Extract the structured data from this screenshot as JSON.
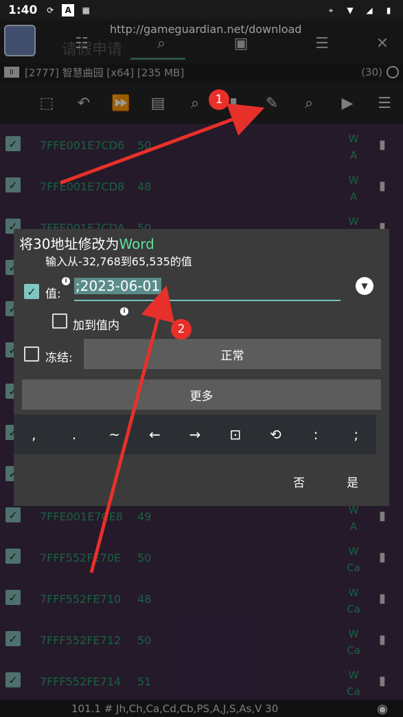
{
  "status": {
    "time": "1:40",
    "icons": [
      "sync-icon",
      "a-icon",
      "keyboard-icon"
    ],
    "right_icons": [
      "location-icon",
      "wifi-icon",
      "signal-icon",
      "battery-icon"
    ]
  },
  "header": {
    "url": "http://gameguardian.net/download",
    "bg_title": "请假申请"
  },
  "process": {
    "pause_label": "II",
    "info": "[2777] 智慧曲园 [x64] [235 MB]",
    "count": "(30)"
  },
  "toolbar": {
    "icons": [
      "select-all-icon",
      "undo-icon",
      "fast-forward-icon",
      "save-icon",
      "search-question-icon",
      "delete-icon",
      "edit-icon",
      "search-icon",
      "play-icon",
      "menu-icon"
    ]
  },
  "list": {
    "rows": [
      {
        "addr": "7FFE001E7CD6",
        "val": "50",
        "flag1": "W",
        "flag2": "A"
      },
      {
        "addr": "7FFE001E7CD8",
        "val": "48",
        "flag1": "W",
        "flag2": "A"
      },
      {
        "addr": "7FFE001E7CDA",
        "val": "50",
        "flag1": "W",
        "flag2": ""
      },
      {
        "addr": "",
        "val": "",
        "flag1": "",
        "flag2": ""
      },
      {
        "addr": "",
        "val": "",
        "flag1": "",
        "flag2": ""
      },
      {
        "addr": "",
        "val": "",
        "flag1": "",
        "flag2": ""
      },
      {
        "addr": "",
        "val": "",
        "flag1": "",
        "flag2": ""
      },
      {
        "addr": "",
        "val": "",
        "flag1": "",
        "flag2": ""
      },
      {
        "addr": "",
        "val": "",
        "flag1": "",
        "flag2": ""
      },
      {
        "addr": "7FFE001E7CE8",
        "val": "49",
        "flag1": "W",
        "flag2": "A"
      },
      {
        "addr": "7FFF552FE70E",
        "val": "50",
        "flag1": "W",
        "flag2": "Ca"
      },
      {
        "addr": "7FFF552FE710",
        "val": "48",
        "flag1": "W",
        "flag2": "Ca"
      },
      {
        "addr": "7FFF552FE712",
        "val": "50",
        "flag1": "W",
        "flag2": "Ca"
      },
      {
        "addr": "7FFF552FE714",
        "val": "51",
        "flag1": "W",
        "flag2": "Ca"
      }
    ]
  },
  "bottom": {
    "text": "101.1 # Jh,Ch,Ca,Cd,Cb,PS,A,J,S,As,V 30"
  },
  "dialog": {
    "title_prefix": "将30地址修改为",
    "title_type": "Word",
    "range": "输入从-32,768到65,535的值",
    "value_label": "值:",
    "value": ";2023-06-01",
    "add_to_value_label": "加到值内",
    "freeze_label": "冻结:",
    "normal_button": "正常",
    "more_button": "更多",
    "keys": [
      ",",
      ".",
      "~",
      "←",
      "→",
      "⊡",
      "⟲",
      ":",
      ";"
    ],
    "no_button": "否",
    "yes_button": "是"
  },
  "annotations": {
    "badge1": "1",
    "badge2": "2",
    "arrow_color": "#e8302a"
  }
}
